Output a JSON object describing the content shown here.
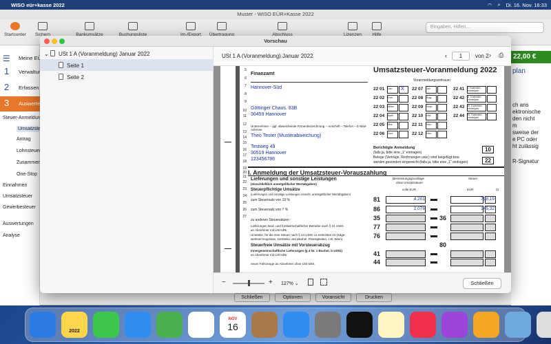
{
  "menubar": {
    "app": "WISO eür+kasse 2022",
    "date": "Di. 16. Nov. 16:33"
  },
  "app": {
    "title": "Muster - WISO EÜR+Kasse 2022",
    "toolbar": [
      "Startcenter",
      "Sichern",
      "Bankumsätze buchen",
      "Buchungsliste",
      "Im-/Export",
      "Übertragung",
      "Abschluss",
      "Lizenzen",
      "Hilfe"
    ],
    "search_placeholder": "Eingaben, Hilfen...",
    "price": "22,00 €",
    "steps": [
      {
        "n": "1",
        "label": "Verwaltung"
      },
      {
        "n": "2",
        "label": "Erfassen"
      },
      {
        "n": "3",
        "label": "Auswerten"
      }
    ],
    "top_label": "Meine EÜ",
    "tree": [
      "Steuer-Anmeldungen",
      "Umsatzsteuer",
      "Antrag",
      "Lohnsteuer",
      "Zusammenfassende",
      "One-Stop",
      "Einnahmen",
      "Umsatzsteuer",
      "Gewerbesteuer",
      "Auswertungen",
      "Analyse"
    ],
    "right_texts": [
      "plan",
      "ch ans",
      "ektronische",
      "den nicht",
      "m",
      "sweise der",
      "e PC oder",
      "ht zulässig",
      "R-Signatur"
    ],
    "bottom_buttons": [
      "Schließen",
      "Optionen",
      "Voransicht",
      "Drucken"
    ]
  },
  "dialog": {
    "title": "Vorschau",
    "tree_root": "USt 1 A (Voranmeldung) Januar 2022",
    "pages": [
      "Seite 1",
      "Seite 2"
    ],
    "header_title": "USt 1 A (Voranmeldung) Januar 2022",
    "page_input": "1",
    "page_total": "von 2",
    "zoom": "127%",
    "zoom_level": 0.5,
    "close": "Schließen"
  },
  "form": {
    "finanzamt_label": "Finanzamt",
    "finanzamt": "Hannover-Süd",
    "fa_street": "Göttinger Chaus. 83B",
    "fa_city": "30459 Hannover",
    "title": "Umsatzsteuer-Voranmeldung 2022",
    "period_title": "Voranmeldungszeitraum",
    "unternehmer_label": "Unternehmer – ggf. abweichende Firmenbezeichnung – Anschrift – Telefon – E-Mail-Adresse",
    "name": "Theo Tester (Musterabweichung)",
    "street": "Testweg 49",
    "city": "30519 Hannover",
    "phone": "123456786",
    "berichtigte": "Berichtigte Anmeldung",
    "berichtigte_sub": "(falls ja, bitte eine „1“ eintragen)",
    "belege": "Belege (Verträge, Rechnungen usw.) sind beigefügt bzw.",
    "belege_sub": "werden gesondert eingereicht (falls ja, bitte eine „1“ eintragen)",
    "k10": "10",
    "k22": "22",
    "section": "I. Anmeldung der Umsatzsteuer-Vorauszahlung",
    "lieferungen": "Lieferungen und sonstige Leistungen",
    "lieferungen_sub": "(einschließlich unentgeltlicher Wertabgaben)",
    "col_bemessung": "Bemessungsgrundlage",
    "col_bemessung2": "ohne Umsatzsteuer",
    "col_steuer": "Steuer",
    "col_voll": "volle EUR",
    "col_eur": "EUR",
    "col_ct": "Ct",
    "steuerpflichtig": "Steuerpflichtige Umsätze",
    "stp_sub": "(Lieferungen und sonstige Leistungen einschl. unentgeltlicher Wertabgaben)",
    "r19": "zum Steuersatz von 19 %",
    "r7": "zum Steuersatz von 7 %",
    "r_andere": "zu anderen Steuersätzen",
    "r_land": "Lieferungen land- und forstwirtschaftlicher Betriebe nach § 24 UStG",
    "r_land2": "an Abnehmer mit USt-IdNr.",
    "r_24": "Umsätze, für die eine Steuer nach § 24 UStG zu entrichten ist (Säge-",
    "r_24b": "werkserzeugnisse, Getränke und alkohol. Flüssigkeiten, z.B. Wein)",
    "steuerfrei": "Steuerfreie Umsätze mit Vorsteuerabzug",
    "igl": "Innergemeinschaftliche Lieferungen (§ 4 Nr. 1 Buchst. b UStG)",
    "igl2": "an Abnehmer mit USt-IdNr.",
    "fahrzeuge": "neuer Fahrzeuge an Abnehmer ohne USt-IdNr.",
    "val_81": "4.201",
    "val_81_tax": "798,19",
    "val_86": "2.076",
    "val_86_tax": "145,32",
    "month_codes": [
      [
        "22 01",
        "Jan."
      ],
      [
        "22 02",
        "Feb."
      ],
      [
        "22 03",
        "März"
      ],
      [
        "22 04",
        "April"
      ],
      [
        "22 05",
        "Mai"
      ],
      [
        "22 06",
        "Juni"
      ]
    ],
    "month_codes2": [
      [
        "22 07",
        "Juli"
      ],
      [
        "22 08",
        "Aug."
      ],
      [
        "22 09",
        "Sept."
      ],
      [
        "22 10",
        "Okt."
      ],
      [
        "22 11",
        "Nov."
      ],
      [
        "22 12",
        "Dez."
      ]
    ],
    "quarter_codes": [
      [
        "22 41",
        "I. Kalender-vierteljahr"
      ],
      [
        "22 42",
        "II. Kalender-vierteljahr"
      ],
      [
        "22 43",
        "III. Kalender-vierteljahr"
      ],
      [
        "22 44",
        "IV. Kalender-vierteljahr"
      ]
    ],
    "x_mark": "X",
    "row_codes": [
      "81",
      "86",
      "35",
      "77",
      "76",
      "41",
      "44"
    ],
    "mid_codes": [
      "36",
      "80"
    ],
    "line_numbers": [
      "5",
      "6",
      "7",
      "8",
      "9",
      "10",
      "11",
      "12",
      "13",
      "14",
      "15",
      "16",
      "17",
      "18",
      "19",
      "20",
      "21",
      "22",
      "23",
      "24",
      "25",
      "26",
      "27"
    ]
  },
  "dock": [
    "Finder",
    "WISO 2022",
    "Messages",
    "Mail",
    "Maps",
    "Photos",
    "Calendar",
    "Contacts",
    "Safari",
    "System",
    "TV",
    "Notes",
    "Music",
    "Podcasts",
    "Pages",
    "Downloads",
    "Trash"
  ],
  "dock_badge": "2022",
  "calendar_month": "NOV",
  "calendar_day": "16"
}
